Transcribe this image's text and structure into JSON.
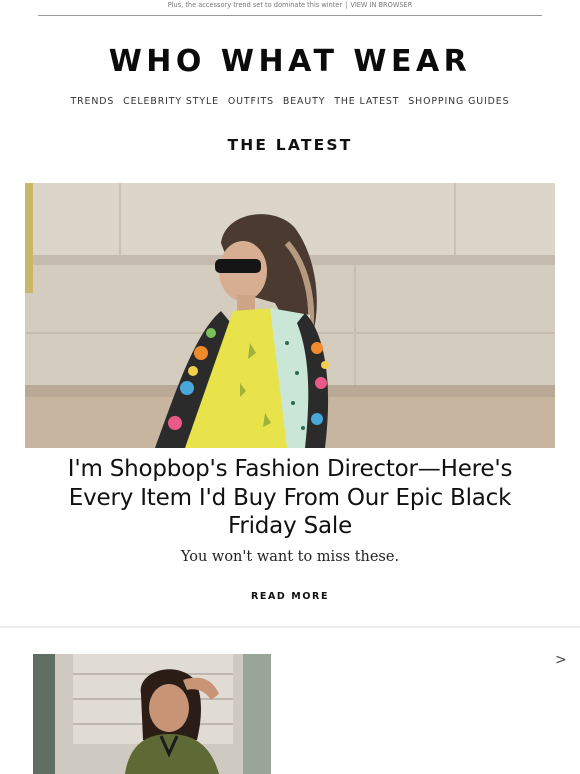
{
  "preheader": {
    "text": "Plus, the accessory trend set to dominate this winter",
    "separator": "|",
    "view_link": "VIEW IN BROWSER"
  },
  "brand": {
    "logo": "WHO WHAT WEAR"
  },
  "nav": {
    "items": [
      "TRENDS",
      "CELEBRITY STYLE",
      "OUTFITS",
      "BEAUTY",
      "THE LATEST",
      "SHOPPING GUIDES"
    ]
  },
  "section": {
    "title": "THE LATEST"
  },
  "feature": {
    "headline": "I'm Shopbop's Fashion Director—Here's Every Item I'd Buy From Our Epic Black Friday Sale",
    "subhead": "You won't want to miss these.",
    "cta": "READ MORE"
  },
  "carousel": {
    "next_glyph": ">"
  },
  "colors": {
    "text": "#111111",
    "muted": "#777777",
    "wall": "#d8d0c4",
    "dress_yellow": "#e8e34a"
  },
  "icons": {
    "next": "chevron-right-icon"
  }
}
